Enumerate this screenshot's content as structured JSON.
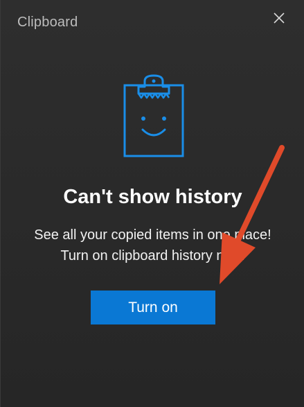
{
  "window": {
    "title": "Clipboard"
  },
  "empty_state": {
    "heading": "Can't show history",
    "line1": "See all your copied items in one place!",
    "line2": "Turn on clipboard history now.",
    "button_label": "Turn on"
  },
  "icons": {
    "close": "close-icon",
    "clipboard": "clipboard-smiley-icon",
    "annotation": "red-arrow"
  },
  "colors": {
    "accent": "#0a78d4",
    "icon_blue": "#1a8ee8",
    "annotation_red": "#e04a2a"
  }
}
